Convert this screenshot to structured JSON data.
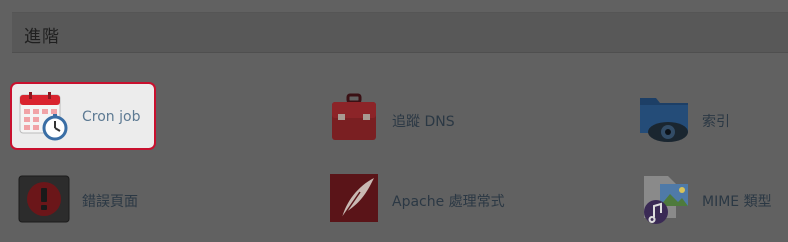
{
  "section": {
    "title": "進階"
  },
  "items": [
    {
      "label": "Cron job",
      "icon": "cron-calendar-clock-icon"
    },
    {
      "label": "追蹤 DNS",
      "icon": "toolbox-icon"
    },
    {
      "label": "索引",
      "icon": "folder-eye-icon"
    },
    {
      "label": "錯誤頁面",
      "icon": "error-page-icon"
    },
    {
      "label": "Apache 處理常式",
      "icon": "apache-feather-icon"
    },
    {
      "label": "MIME 類型",
      "icon": "mime-music-image-icon"
    }
  ],
  "colors": {
    "highlight_border": "#c8102e",
    "overlay": "#616161"
  }
}
